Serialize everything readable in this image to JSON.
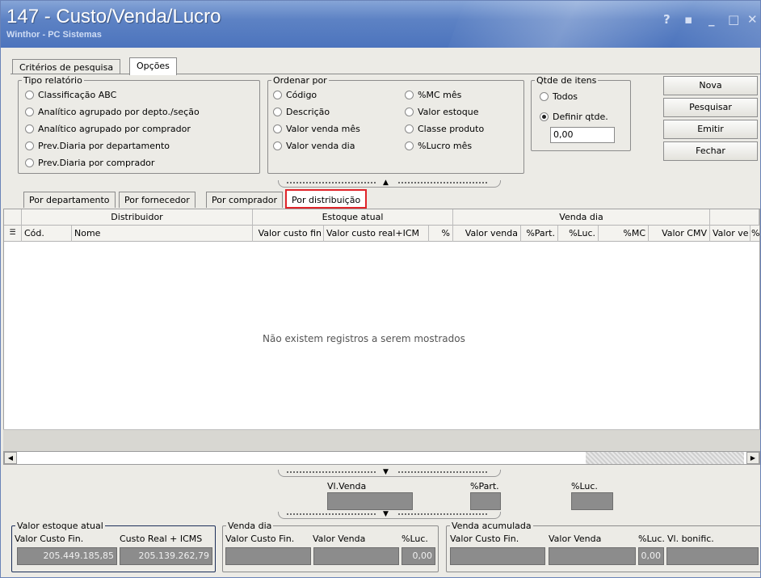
{
  "window": {
    "title": "147 - Custo/Venda/Lucro",
    "subtitle": "Winthor - PC Sistemas",
    "controls": [
      "?",
      "▪",
      "_",
      "□",
      "✕"
    ]
  },
  "top_tabs": [
    "Critérios de pesquisa",
    "Opções"
  ],
  "tipo_relatorio": {
    "legend": "Tipo relatório",
    "options": [
      "Classificação ABC",
      "Analítico agrupado por depto./seção",
      "Analítico agrupado por comprador",
      "Prev.Diaria por departamento",
      "Prev.Diaria por comprador"
    ]
  },
  "ordenar_por": {
    "legend": "Ordenar por",
    "col1": [
      "Código",
      "Descrição",
      "Valor venda mês",
      "Valor venda dia"
    ],
    "col2": [
      "%MC mês",
      "Valor estoque",
      "Classe produto",
      "%Lucro mês"
    ]
  },
  "qtde_itens": {
    "legend": "Qtde de itens",
    "options": [
      "Todos",
      "Definir qtde."
    ],
    "selected": "Definir qtde.",
    "value": "0,00"
  },
  "buttons": {
    "nova": "Nova",
    "pesquisar": "Pesquisar",
    "emitir": "Emitir",
    "fechar": "Fechar"
  },
  "sub_tabs": [
    "Por departamento",
    "Por fornecedor",
    "Por comprador",
    "Por distribuição"
  ],
  "grid": {
    "group_headers": [
      "Distribuidor",
      "Estoque atual",
      "Venda dia"
    ],
    "columns": [
      "Cód.",
      "Nome",
      "Valor custo fin",
      "Valor custo real+ICM",
      "%",
      "Valor venda",
      "%Part.",
      "%Luc.",
      "%MC",
      "Valor CMV",
      "Valor ve",
      "%F"
    ],
    "empty_message": "Não existem registros a serem mostrados"
  },
  "totals": {
    "vl_venda": "Vl.Venda",
    "part": "%Part.",
    "luc": "%Luc."
  },
  "valor_estoque": {
    "legend": "Valor estoque  atual",
    "label1": "Valor Custo Fin.",
    "label2": "Custo Real + ICMS",
    "value1": "205.449.185,85",
    "value2": "205.139.262,79"
  },
  "venda_dia": {
    "legend": "Venda dia",
    "label1": "Valor Custo Fin.",
    "label2": "Valor Venda",
    "label3": "%Luc.",
    "value3": "0,00"
  },
  "venda_acumulada": {
    "legend": "Venda acumulada",
    "label1": "Valor Custo Fin.",
    "label2": "Valor Venda",
    "label3": "%Luc.",
    "label4": "Vl. bonific.",
    "value3": "0,00"
  },
  "colors": {
    "titlebar": "#5d82c4",
    "highlight": "#e0242a",
    "readonly_field": "#8c8c8c"
  }
}
